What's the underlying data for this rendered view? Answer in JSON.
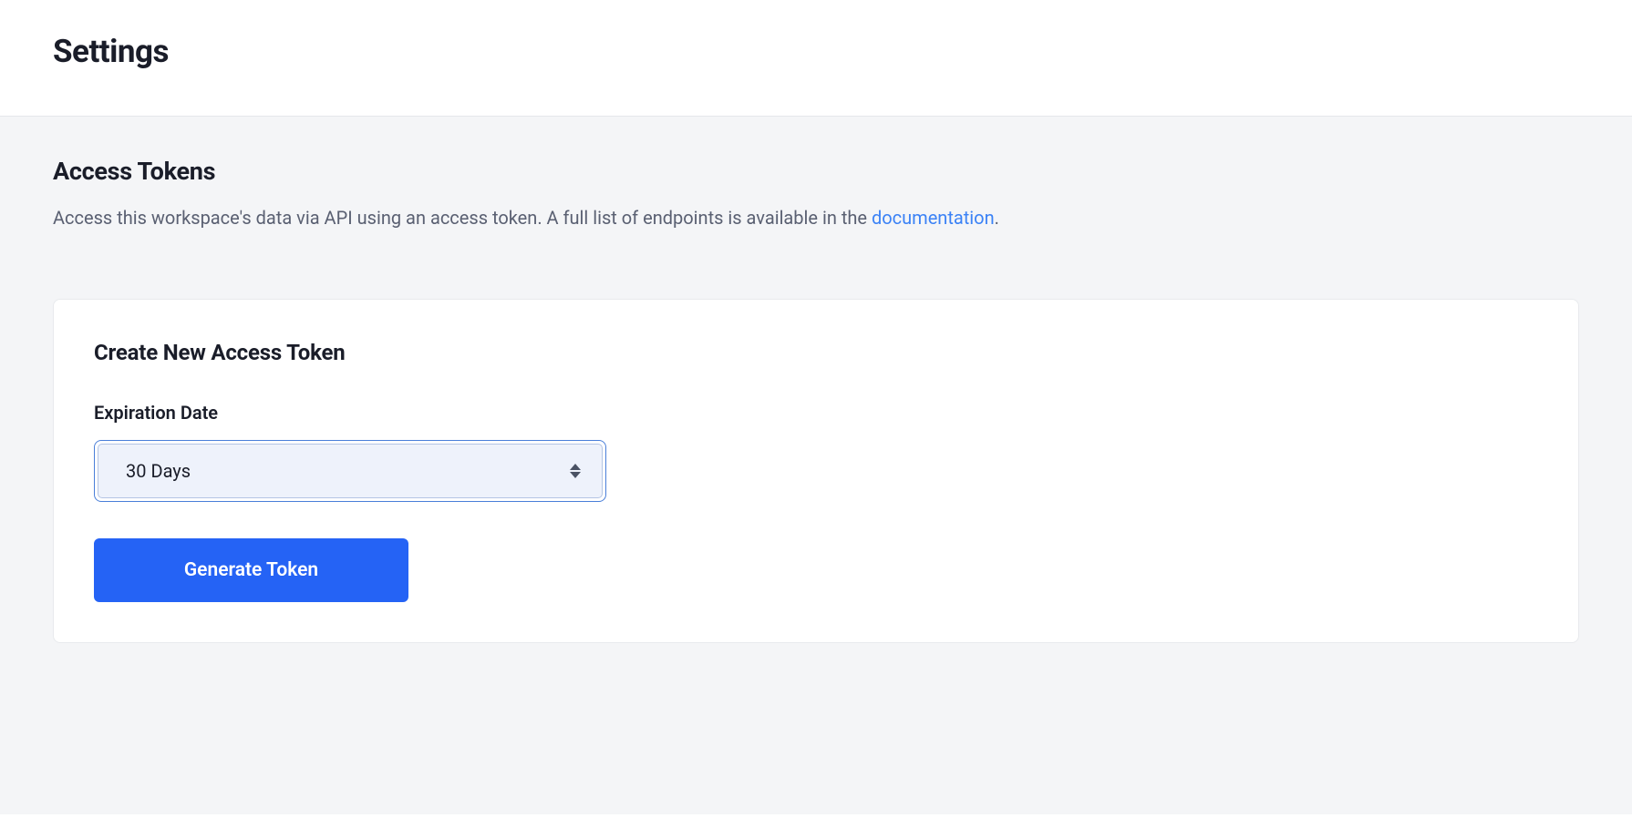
{
  "header": {
    "title": "Settings"
  },
  "section": {
    "title": "Access Tokens",
    "description_prefix": "Access this workspace's data via API using an access token. A full list of endpoints is available in the ",
    "documentation_link_text": "documentation",
    "description_suffix": "."
  },
  "card": {
    "title": "Create New Access Token",
    "expiration_label": "Expiration Date",
    "expiration_selected": "30 Days",
    "generate_button_label": "Generate Token"
  }
}
